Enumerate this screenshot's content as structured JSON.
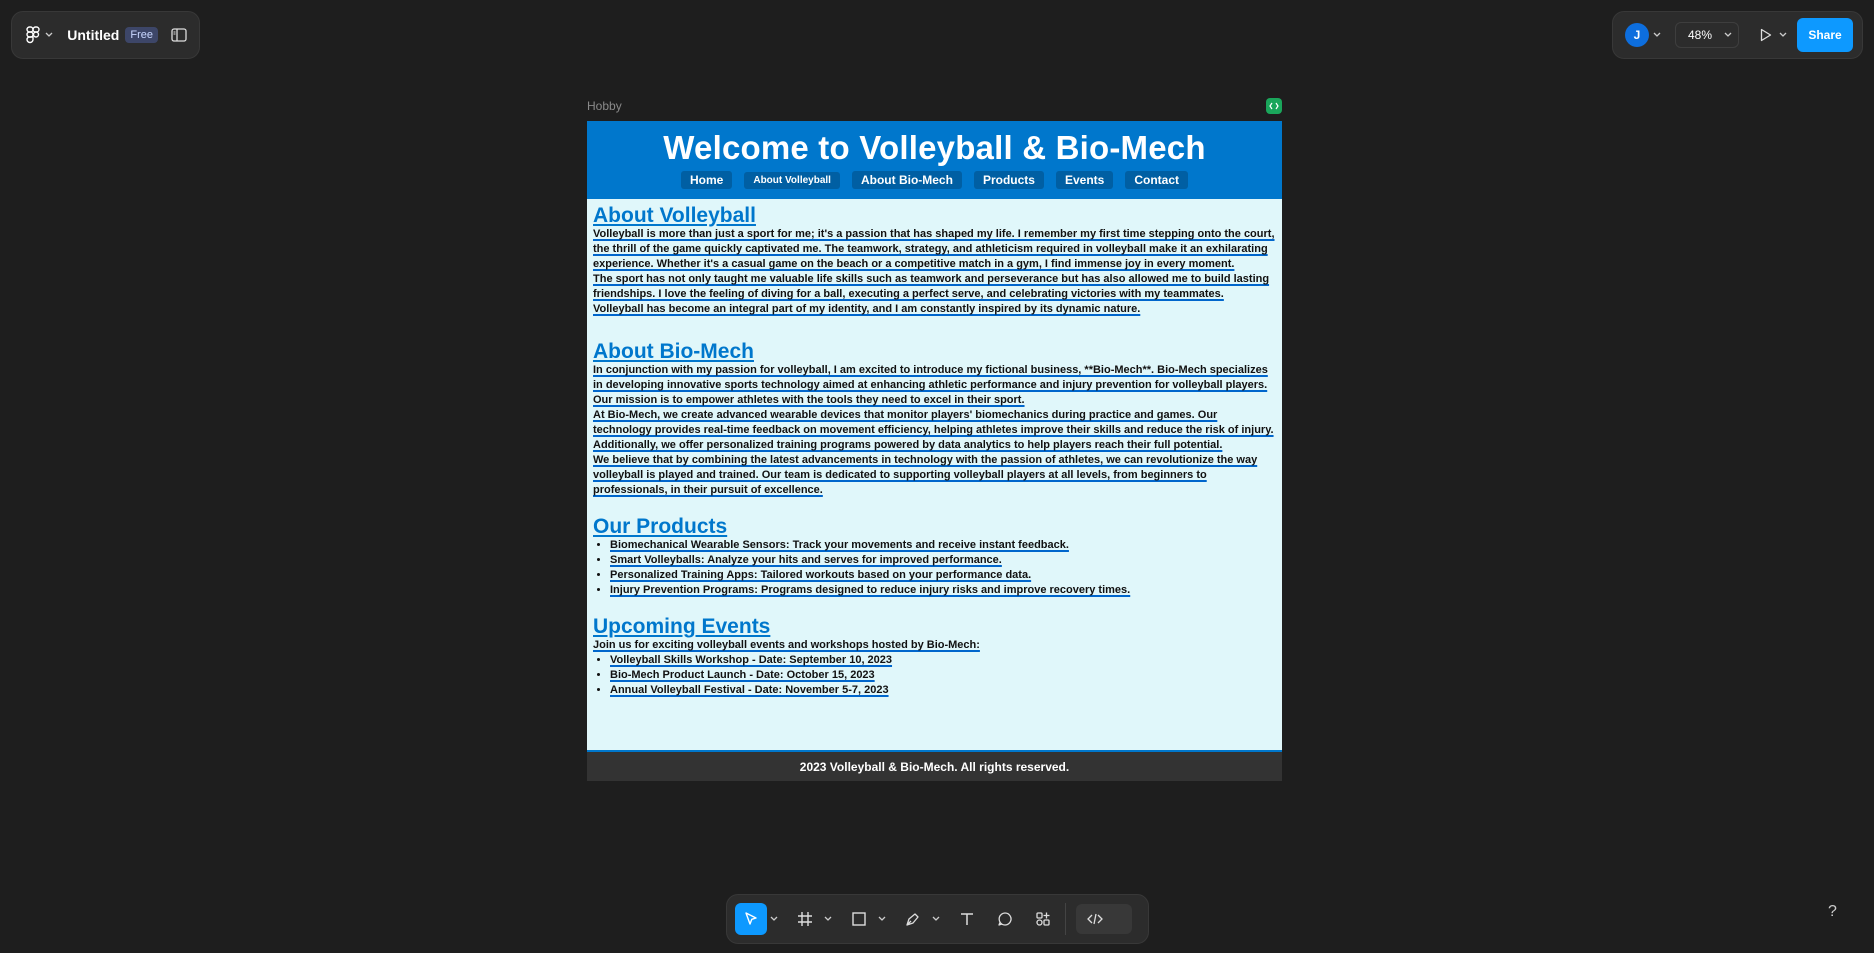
{
  "file": {
    "title": "Untitled",
    "plan_badge": "Free"
  },
  "top_right": {
    "avatar_initial": "J",
    "zoom": "48%",
    "share_label": "Share"
  },
  "frame": {
    "label": "Hobby"
  },
  "site": {
    "title": "Welcome to Volleyball & Bio-Mech",
    "nav": [
      "Home",
      "About Volleyball",
      "About Bio-Mech",
      "Products",
      "Events",
      "Contact"
    ],
    "about_volleyball": {
      "heading": "About Volleyball",
      "p1": "Volleyball is more than just a sport for me; it's a passion that has shaped my life. I remember my first time stepping onto the court, the thrill of the game quickly captivated me. The teamwork, strategy, and athleticism required in volleyball make it an exhilarating experience. Whether it's a casual game on the beach or a competitive match in a gym, I find immense joy in every moment.",
      "p2": "The sport has not only taught me valuable life skills such as teamwork and perseverance but has also allowed me to build lasting friendships. I love the feeling of diving for a ball, executing a perfect serve, and celebrating victories with my teammates. Volleyball has become an integral part of my identity, and I am constantly inspired by its dynamic nature."
    },
    "about_biomech": {
      "heading": "About Bio-Mech",
      "p1": "In conjunction with my passion for volleyball, I am excited to introduce my fictional business, **Bio-Mech**. Bio-Mech specializes in developing innovative sports technology aimed at enhancing athletic performance and injury prevention for volleyball players. Our mission is to empower athletes with the tools they need to excel in their sport.",
      "p2": "At Bio-Mech, we create advanced wearable devices that monitor players' biomechanics during practice and games. Our technology provides real-time feedback on movement efficiency, helping athletes improve their skills and reduce the risk of injury. Additionally, we offer personalized training programs powered by data analytics to help players reach their full potential.",
      "p3": "We believe that by combining the latest advancements in technology with the passion of athletes, we can revolutionize the way volleyball is played and trained. Our team is dedicated to supporting volleyball players at all levels, from beginners to professionals, in their pursuit of excellence."
    },
    "products": {
      "heading": "Our Products",
      "items": [
        "Biomechanical Wearable Sensors: Track your movements and receive instant feedback.",
        "Smart Volleyballs: Analyze your hits and serves for improved performance.",
        "Personalized Training Apps: Tailored workouts based on your performance data.",
        "Injury Prevention Programs: Programs designed to reduce injury risks and improve recovery times."
      ]
    },
    "events": {
      "heading": "Upcoming Events",
      "intro": "Join us for exciting volleyball events and workshops hosted by Bio-Mech:",
      "items": [
        "Volleyball Skills Workshop - Date: September 10, 2023",
        "Bio-Mech Product Launch - Date: October 15, 2023",
        "Annual Volleyball Festival - Date: November 5-7, 2023"
      ]
    },
    "footer": "2023 Volleyball & Bio-Mech. All rights reserved."
  },
  "toolbar": {
    "tools": [
      "move-icon",
      "frame-icon",
      "rectangle-icon",
      "pen-icon",
      "text-icon",
      "comment-icon",
      "actions-icon"
    ],
    "help": "?"
  },
  "colors": {
    "canvas_bg": "#1e1e1e",
    "panel_bg": "#2c2c2c",
    "accent": "#0d99ff",
    "site_header": "#0077cc",
    "site_bg": "#e0f7fa",
    "footer_bg": "#333333"
  }
}
